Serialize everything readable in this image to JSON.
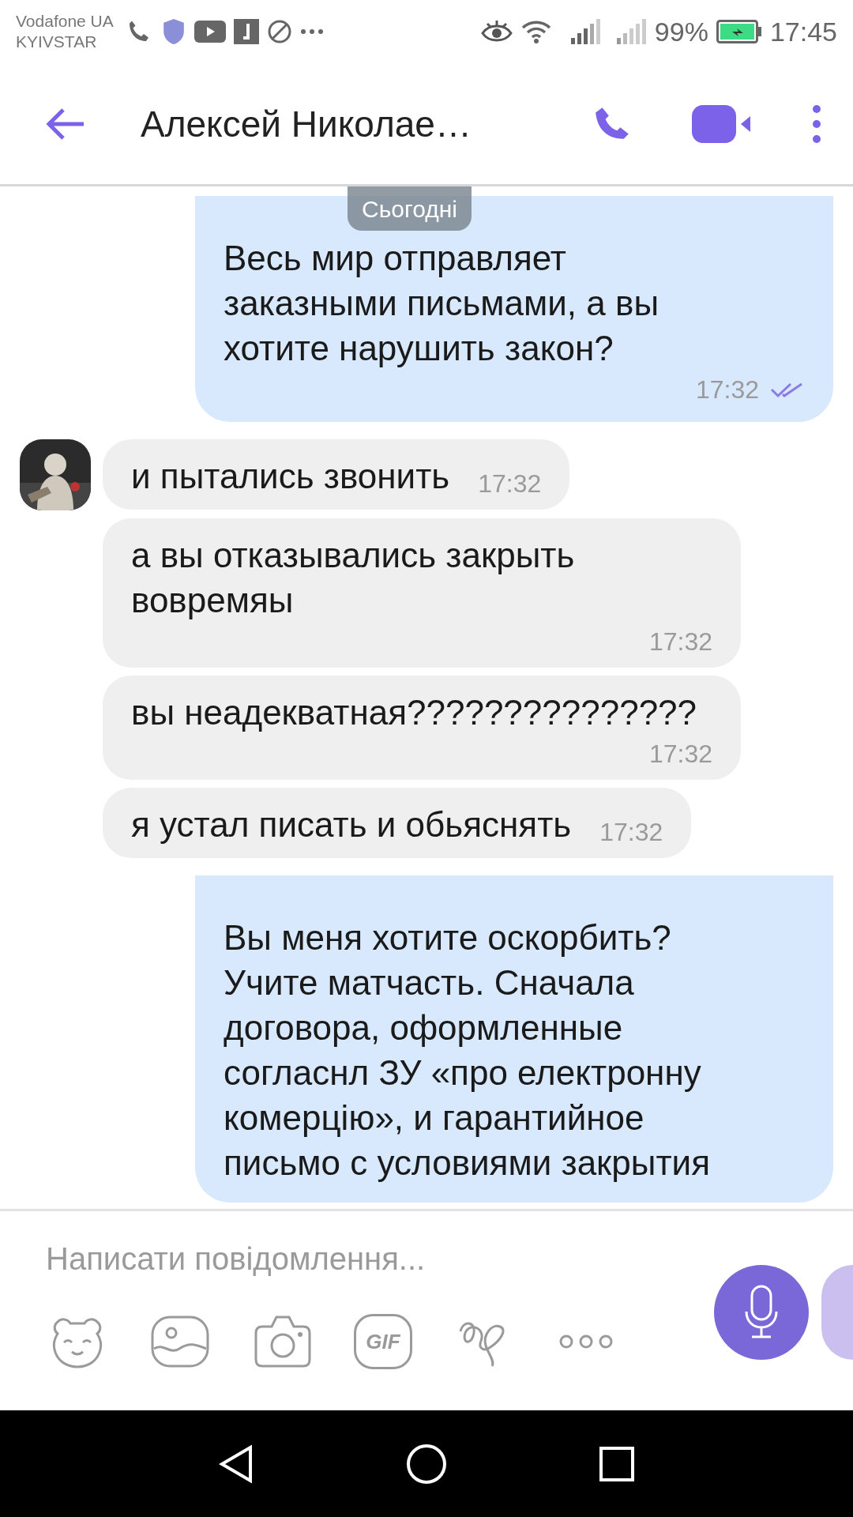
{
  "status_bar": {
    "carriers": [
      "Vodafone UA",
      "KYIVSTAR"
    ],
    "battery": "99%",
    "time": "17:45"
  },
  "header": {
    "title": "Алексей Николае…"
  },
  "date_badge": "Сьогодні",
  "messages": [
    {
      "kind": "outgoing",
      "text": "Весь мир отправляет заказными письмами, а вы хотите нарушить закон?",
      "time": "17:32",
      "read": true
    },
    {
      "kind": "incoming",
      "text": "и пытались звонить",
      "time": "17:32",
      "avatar": true
    },
    {
      "kind": "incoming",
      "text": "а вы отказывались закрыть вовремяы",
      "time": "17:32"
    },
    {
      "kind": "incoming",
      "text": "вы неадекватная???????????????",
      "time": "17:32"
    },
    {
      "kind": "incoming",
      "text": "я устал писать и обьяснять",
      "time": "17:32"
    },
    {
      "kind": "outgoing",
      "text": "Вы меня хотите оскорбить? Учите матчасть. Сначала договора, оформленные согласнл ЗУ «про електронну комерцію», и гарантийное письмо с условиями закрытия"
    }
  ],
  "composer": {
    "placeholder": "Написати повідомлення...",
    "gif_label": "GIF"
  }
}
